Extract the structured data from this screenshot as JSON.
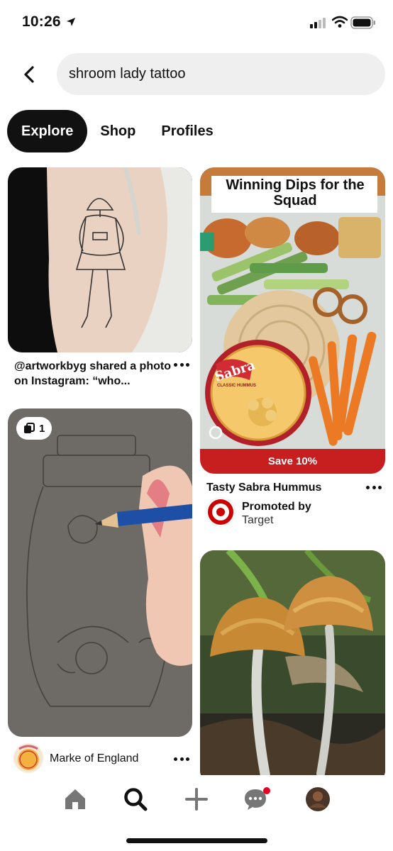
{
  "status": {
    "time": "10:26"
  },
  "search": {
    "query": "shroom lady tattoo"
  },
  "tabs": [
    {
      "label": "Explore",
      "active": true
    },
    {
      "label": "Shop",
      "active": false
    },
    {
      "label": "Profiles",
      "active": false
    }
  ],
  "pins": {
    "tattoo": {
      "title": "@artworkbyg shared a photo on Instagram: “who..."
    },
    "drawing": {
      "badge_count": "1",
      "author": "Marke of England",
      "avatar_text": "Marke of England"
    },
    "ad": {
      "headline": "Winning Dips for the Squad",
      "brand_label": "Sabra",
      "product_label": "CLASSIC HUMMUS",
      "save_label": "Save 10%",
      "title": "Tasty Sabra Hummus",
      "promoted_label": "Promoted by",
      "advertiser": "Target"
    },
    "mushroom": {}
  },
  "nav": {
    "items": [
      "home",
      "search",
      "create",
      "messages",
      "profile"
    ]
  },
  "colors": {
    "accent": "#e60023",
    "ad_banner": "#c71f1f",
    "tab_active_bg": "#111111",
    "search_bg": "#efefef"
  }
}
